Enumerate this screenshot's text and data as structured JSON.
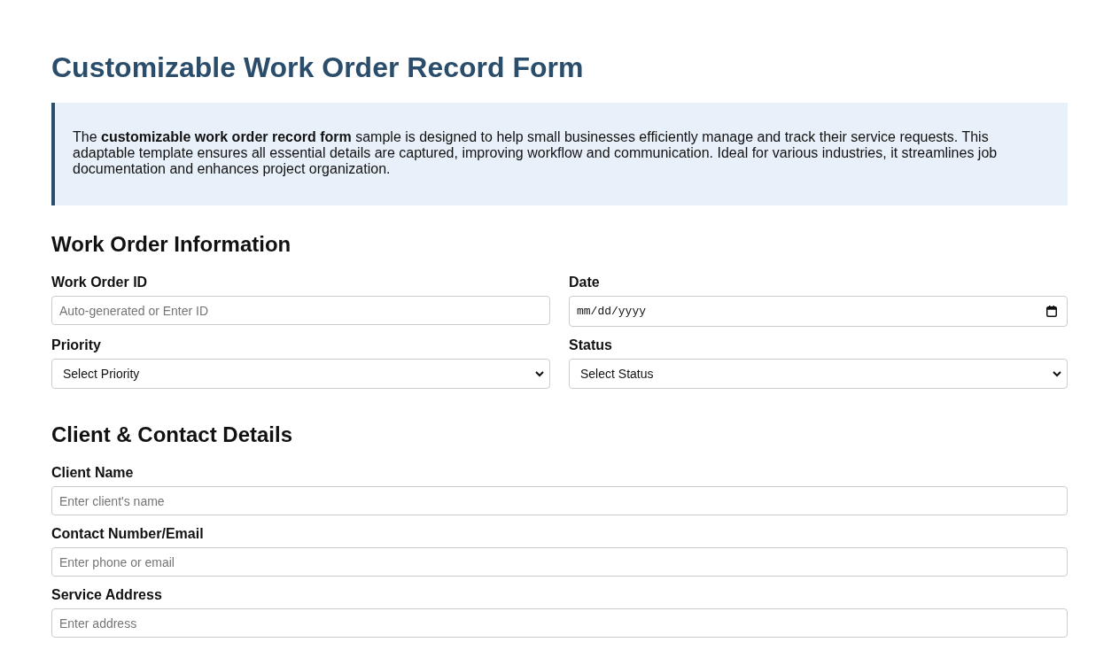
{
  "title": "Customizable Work Order Record Form",
  "intro": "The **customizable work order record form** sample is designed to help small businesses efficiently manage and track their service requests. This adaptable template ensures all essential details are captured, improving workflow and communication. Ideal for various industries, it streamlines job documentation and enhances project organization.",
  "sections": [
    {
      "heading": "Work Order Information",
      "kind": "grid",
      "fields": [
        {
          "kind": "text",
          "label": "Work Order ID",
          "placeholder": "Auto-generated or Enter ID"
        },
        {
          "kind": "date",
          "label": "Date",
          "placeholder": "mm/dd/yyyy"
        },
        {
          "kind": "select",
          "label": "Priority",
          "value": "Select Priority"
        },
        {
          "kind": "select",
          "label": "Status",
          "value": "Select Status"
        }
      ]
    },
    {
      "heading": "Client & Contact Details",
      "kind": "stack",
      "fields": [
        {
          "kind": "text",
          "label": "Client Name",
          "placeholder": "Enter client's name"
        },
        {
          "kind": "text",
          "label": "Contact Number/Email",
          "placeholder": "Enter phone or email"
        },
        {
          "kind": "text",
          "label": "Service Address",
          "placeholder": "Enter address"
        }
      ]
    }
  ]
}
